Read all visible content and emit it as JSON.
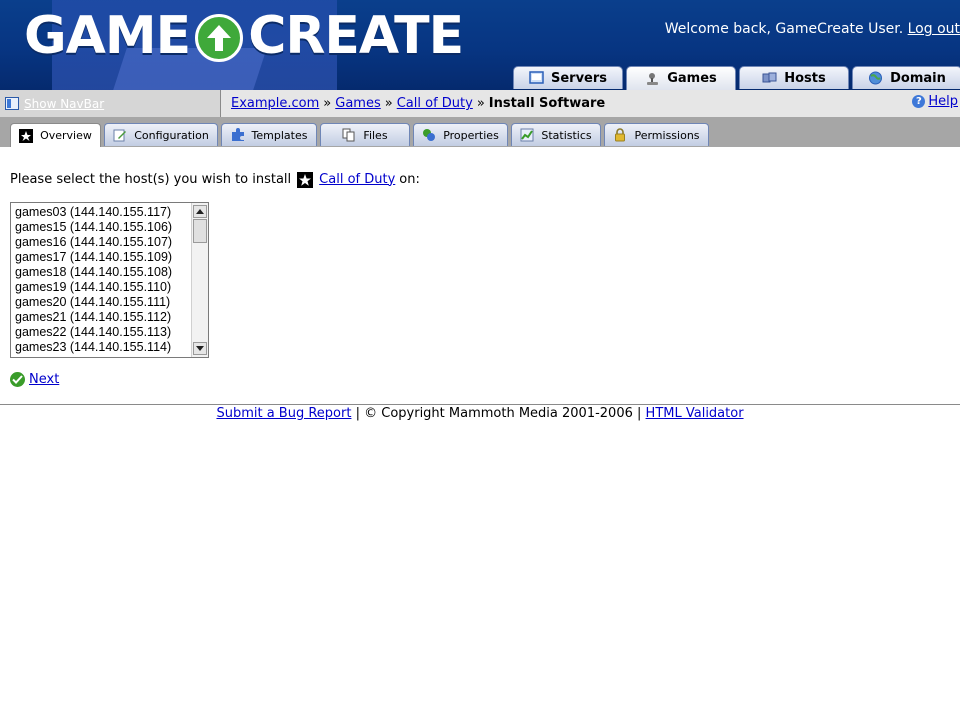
{
  "header": {
    "logo_text_left": "GAME",
    "logo_text_right": "CREATE",
    "welcome_text": "Welcome back, GameCreate User.",
    "logout_label": "Log out"
  },
  "main_tabs": [
    {
      "label": "Servers",
      "icon": "monitor-icon",
      "active": false
    },
    {
      "label": "Games",
      "icon": "joystick-icon",
      "active": true
    },
    {
      "label": "Hosts",
      "icon": "hosts-icon",
      "active": false
    },
    {
      "label": "Domain",
      "icon": "globe-icon",
      "active": false
    }
  ],
  "navbar": {
    "show_navbar_label": "Show NavBar",
    "breadcrumb": [
      "Example.com",
      "Games",
      "Call of Duty"
    ],
    "breadcrumb_separator": "»",
    "breadcrumb_current": "Install Software",
    "help_label": "Help"
  },
  "sub_tabs": [
    {
      "label": "Overview",
      "icon": "game-logo-icon",
      "active": true
    },
    {
      "label": "Configuration",
      "icon": "edit-icon",
      "active": false
    },
    {
      "label": "Templates",
      "icon": "puzzle-icon",
      "active": false
    },
    {
      "label": "Files",
      "icon": "files-icon",
      "active": false
    },
    {
      "label": "Properties",
      "icon": "properties-icon",
      "active": false
    },
    {
      "label": "Statistics",
      "icon": "chart-icon",
      "active": false
    },
    {
      "label": "Permissions",
      "icon": "lock-icon",
      "active": false
    }
  ],
  "content": {
    "prompt_before": "Please select the host(s) you wish to install",
    "game_link": "Call of Duty",
    "prompt_after": "on:",
    "hosts": [
      "games03 (144.140.155.117)",
      "games15 (144.140.155.106)",
      "games16 (144.140.155.107)",
      "games17 (144.140.155.109)",
      "games18 (144.140.155.108)",
      "games19 (144.140.155.110)",
      "games20 (144.140.155.111)",
      "games21 (144.140.155.112)",
      "games22 (144.140.155.113)",
      "games23 (144.140.155.114)"
    ],
    "next_label": "Next"
  },
  "footer": {
    "bug_report_label": "Submit a Bug Report",
    "separator": "|",
    "copyright": "© Copyright Mammoth Media 2001-2006",
    "validator_label": "HTML Validator"
  },
  "colors": {
    "header_blue": "#073582",
    "tab_bg": "#c9d3e8",
    "subbar_gray": "#a6a6a6",
    "link_blue": "#0000cc",
    "check_green": "#3a9c2a"
  }
}
